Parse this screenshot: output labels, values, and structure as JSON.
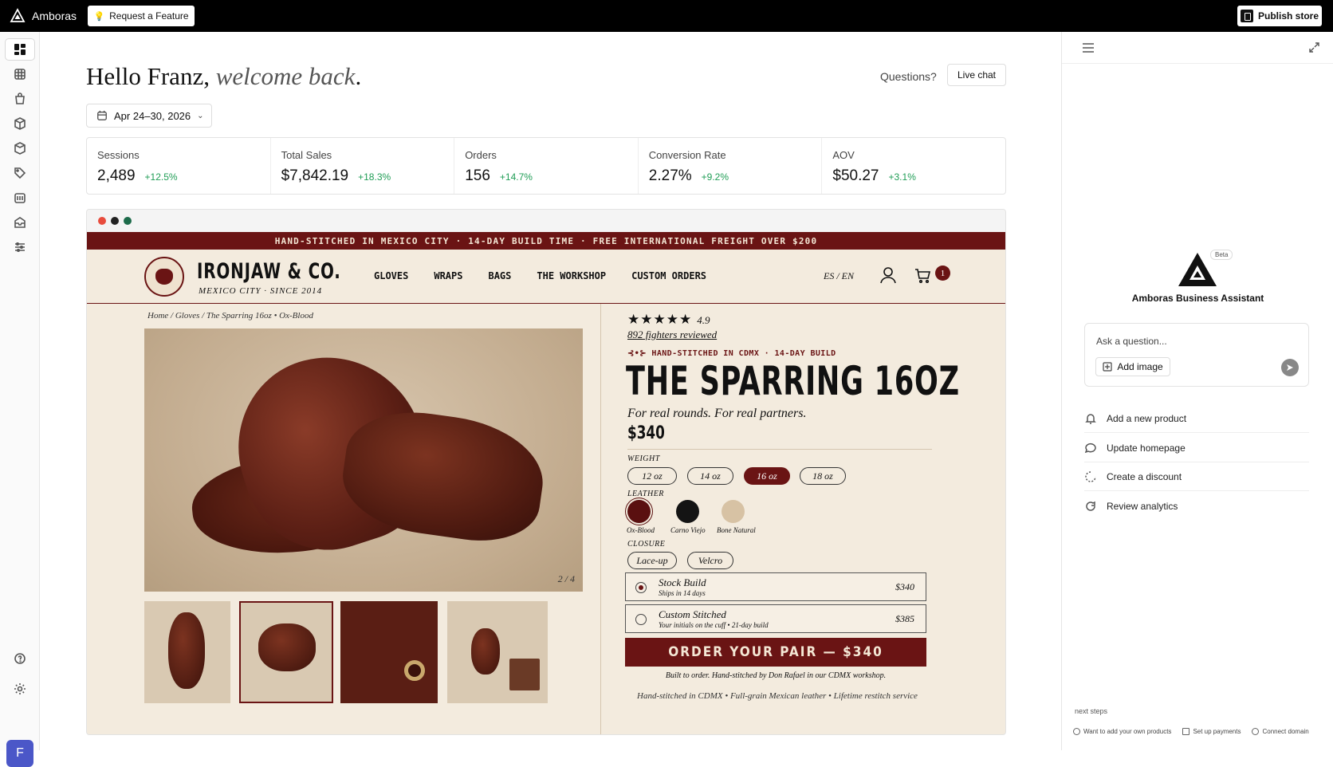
{
  "app": {
    "brand": "Amboras",
    "request_feature": "Request a Feature",
    "publish": "Publish store",
    "avatar_initial": "F"
  },
  "nav": {
    "icons": [
      "dashboard-icon",
      "grid-icon",
      "bag-icon",
      "box-icon",
      "cube-icon",
      "tag-icon",
      "calendar-icon",
      "inbox-icon",
      "sliders-icon"
    ],
    "bottom_icons": [
      "help-icon",
      "settings-icon"
    ]
  },
  "header": {
    "hello": "Hello Franz,",
    "welcome": "welcome back",
    "period": ".",
    "questions": "Questions?",
    "live_chat": "Live chat",
    "date_range": "Apr 24–30, 2026"
  },
  "stats": [
    {
      "label": "Sessions",
      "value": "2,489",
      "change": "+12.5%"
    },
    {
      "label": "Total Sales",
      "value": "$7,842.19",
      "change": "+18.3%"
    },
    {
      "label": "Orders",
      "value": "156",
      "change": "+14.7%"
    },
    {
      "label": "Conversion Rate",
      "value": "2.27%",
      "change": "+9.2%"
    },
    {
      "label": "AOV",
      "value": "$50.27",
      "change": "+3.1%"
    }
  ],
  "store": {
    "announcement": "HAND-STITCHED IN MEXICO CITY · 14-DAY BUILD TIME · FREE INTERNATIONAL FREIGHT OVER $200",
    "name": "IRONJAW & CO.",
    "subtitle": "MEXICO CITY · SINCE 2014",
    "nav": [
      "GLOVES",
      "WRAPS",
      "BAGS",
      "THE WORKSHOP",
      "CUSTOM ORDERS"
    ],
    "lang": "ES / EN",
    "cart_count": "1",
    "breadcrumb": "Home / Gloves / The Sparring 16oz • Ox-Blood",
    "image_counter": "2 / 4",
    "stars": "★★★★★",
    "rating": "4.9",
    "reviews": "892 fighters reviewed",
    "tagline": "HAND-STITCHED IN CDMX · 14-DAY BUILD",
    "title": "THE SPARRING 16OZ",
    "subhead": "For real rounds. For real partners.",
    "price": "$340",
    "weight_label": "WEIGHT",
    "weights": [
      "12 oz",
      "14 oz",
      "16 oz",
      "18 oz"
    ],
    "selected_weight": "16 oz",
    "leather_label": "LEATHER",
    "leathers": [
      {
        "name": "Ox-Blood",
        "color": "#5a1010"
      },
      {
        "name": "Carno Viejo",
        "color": "#141414"
      },
      {
        "name": "Bone Natural",
        "color": "#d7c2a4"
      }
    ],
    "closure_label": "CLOSURE",
    "closures": [
      "Lace-up",
      "Velcro"
    ],
    "builds": [
      {
        "title": "Stock Build",
        "detail": "Ships in 14 days",
        "price": "$340",
        "selected": true
      },
      {
        "title": "Custom Stitched",
        "detail": "Your initials on the cuff • 21-day build",
        "price": "$385",
        "selected": false
      }
    ],
    "order_button": "ORDER YOUR PAIR — $340",
    "built_note": "Built to order. Hand-stitched by Don Rafael in our CDMX workshop.",
    "footer_note": "Hand-stitched in CDMX  •  Full-grain Mexican leather  •  Lifetime restitch service"
  },
  "assistant": {
    "beta": "Beta",
    "title": "Amboras Business Assistant",
    "placeholder": "Ask a question...",
    "add_image": "Add image",
    "actions": [
      "Add a new product",
      "Update homepage",
      "Create a discount",
      "Review analytics"
    ],
    "next_steps_label": "next steps",
    "next_steps": [
      "Want to add your own products",
      "Set up payments",
      "Connect domain"
    ]
  },
  "colors": {
    "accent": "#6a1414",
    "positive": "#1f9d55",
    "avatar": "#4b57c8"
  }
}
